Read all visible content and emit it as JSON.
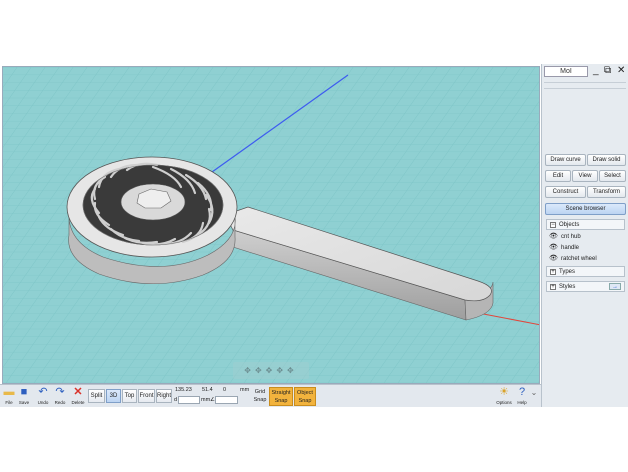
{
  "window": {
    "logo": "MoI",
    "controls": [
      "_",
      "⧉",
      "✕"
    ]
  },
  "panel": {
    "buttons": {
      "draw_curve": "Draw curve",
      "draw_solid": "Draw solid",
      "edit": "Edit",
      "view": "View",
      "select": "Select",
      "construct": "Construct",
      "transform": "Transform",
      "scene_browser": "Scene browser"
    },
    "tree": {
      "objects_header": "Objects",
      "objects": [
        {
          "label": "cnt hub"
        },
        {
          "label": "handle"
        },
        {
          "label": "ratchet wheel"
        }
      ],
      "types_header": "Types",
      "styles_header": "Styles",
      "styles_arrow": "→"
    }
  },
  "toolbar": {
    "file": "File",
    "save": "Save",
    "undo": "Undo",
    "redo": "Redo",
    "delete": "Delete",
    "views": {
      "split": "Split",
      "three_d": "3D",
      "top": "Top",
      "front": "Front",
      "right": "Right",
      "active": "3D"
    },
    "coords": {
      "x": "135.23",
      "y": "51.4",
      "z": "0",
      "unit": "mm",
      "d_label": "d",
      "mm_label": "mm",
      "angle_label": "∠"
    },
    "grid_snap": {
      "line1": "Grid",
      "line2": "Snap"
    },
    "straight_snap": {
      "line1": "Straight",
      "line2": "Snap"
    },
    "object_snap": {
      "line1": "Object",
      "line2": "Snap"
    },
    "options": "Options",
    "help": "Help"
  },
  "colors": {
    "viewport_bg": "#8fd0d2",
    "grid_line": "#7fc2c4",
    "snap_on": "#f2b33d",
    "axis_blue": "#3d5bf0",
    "axis_red": "#e2453a"
  },
  "icons": {
    "file": "folder-icon",
    "save": "floppy-icon",
    "undo": "undo-icon",
    "redo": "redo-icon",
    "delete": "delete-x-icon",
    "options": "options-icon",
    "help": "help-icon"
  }
}
